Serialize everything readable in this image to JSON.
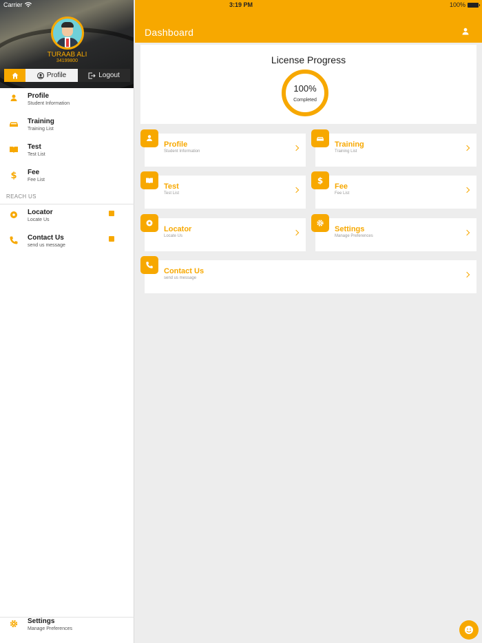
{
  "status_bar": {
    "carrier": "Carrier",
    "time": "3:19 PM",
    "battery": "100%"
  },
  "sidebar": {
    "user_name": "TURAAB ALI",
    "user_id": "34199800",
    "tabs": {
      "profile": "Profile",
      "logout": "Logout"
    },
    "items": [
      {
        "title": "Profile",
        "subtitle": "Student Information"
      },
      {
        "title": "Training",
        "subtitle": "Training List"
      },
      {
        "title": "Test",
        "subtitle": "Test List"
      },
      {
        "title": "Fee",
        "subtitle": "Fee List"
      }
    ],
    "section_label": "REACH US",
    "reach_items": [
      {
        "title": "Locator",
        "subtitle": "Locate Us"
      },
      {
        "title": "Contact Us",
        "subtitle": "send us message"
      }
    ],
    "bottom_item": {
      "title": "Settings",
      "subtitle": "Manage Preferences"
    }
  },
  "header": {
    "title": "Dashboard"
  },
  "progress": {
    "title": "License Progress",
    "value": "100%",
    "label": "Completed",
    "fraction": 1.0
  },
  "tiles": [
    {
      "title": "Profile",
      "subtitle": "Student Information",
      "icon": "user-icon"
    },
    {
      "title": "Training",
      "subtitle": "Training List",
      "icon": "car-icon"
    },
    {
      "title": "Test",
      "subtitle": "Test List",
      "icon": "book-icon"
    },
    {
      "title": "Fee",
      "subtitle": "Fee List",
      "icon": "dollar-icon"
    },
    {
      "title": "Locator",
      "subtitle": "Locate Us",
      "icon": "location-icon"
    },
    {
      "title": "Settings",
      "subtitle": "Manage Preferences",
      "icon": "gear-icon"
    },
    {
      "title": "Contact Us",
      "subtitle": "send us message",
      "icon": "phone-icon"
    }
  ],
  "colors": {
    "accent": "#f7a800",
    "background": "#ededed"
  }
}
